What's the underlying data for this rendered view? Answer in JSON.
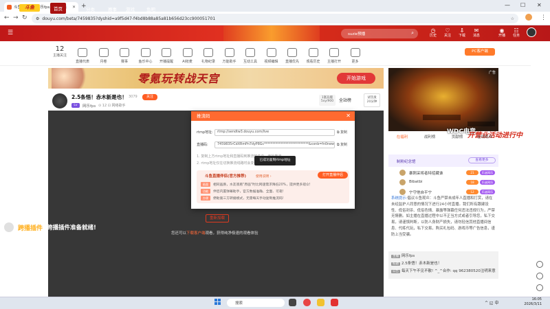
{
  "browser": {
    "tab_title": "斗鱼fps直播_网乐fps直播_网乐",
    "url": "douyu.com/beta/7459835?dyshid=a9f5d47-f4bd8b88a85a81b656d23cc900051701"
  },
  "header": {
    "logo": "斗鱼",
    "nav": [
      "首页",
      "直播",
      "分类",
      "赛事",
      "游戏",
      "鱼吧"
    ],
    "search_placeholder": "suzie预播",
    "icons": [
      {
        "icon": "history-icon",
        "label": "历史"
      },
      {
        "icon": "follow-icon",
        "label": "关注"
      },
      {
        "icon": "download-icon",
        "label": "下载"
      },
      {
        "icon": "message-icon",
        "label": "消息"
      },
      {
        "icon": "live-icon",
        "label": "开播"
      },
      {
        "icon": "task-icon",
        "label": "任务"
      }
    ]
  },
  "categories": {
    "follow_count": "12",
    "follow_label": "主播关注",
    "items": [
      "直播代表",
      "月卷",
      "赛事",
      "鱼乐中心",
      "开播提醒",
      "Al抢麦",
      "礼物纪录",
      "万能助手",
      "互动工具",
      "视频编辑",
      "直播优先",
      "观看历史",
      "主播打开",
      "更多"
    ],
    "pc_button": "PC客户端"
  },
  "ad": {
    "title": "零氪玩转战天宫",
    "button": "开始游戏"
  },
  "stream": {
    "title": "2.5条悟！赤木新是也！",
    "heat": "3079",
    "follow_label": "关注",
    "level": "Lv",
    "streamer": "网乐fps",
    "meta": "⊙ 12  ⊡ 网络歌手",
    "rank_box": "1富兵版\n5xy/900",
    "all_rank": "全站榜",
    "gift_box": "试玩发\n20分钟",
    "plugin_1": "跨播插件",
    "plugin_2": "跨播插件准备就绪!",
    "retry": "重新加载",
    "hint_pre": "您还可以",
    "hint_link": "下载客户端",
    "hint_post": "观看，获得纯净极速的观看体验"
  },
  "modal": {
    "title": "推流码",
    "rtmp_label": "rtmp地址:",
    "rtmp_value": "rtmp://sendtw3.douyu.com/live",
    "key_label": "直播码:",
    "key_value": "7459835rCdXRmPn7dyP8Gc***************************&conb=fn0newsa",
    "copy": "复制",
    "note1": "1. 复制上方rtmp地址和直播码到推流软件中，开始推流",
    "note2": "2. rtmp地址仅在切换推流线路时会变化，直播码有效期为5分钟",
    "toast": "已成功复制rtmp地址",
    "promo_title": "斗鱼直播伴侣(官方推荐)",
    "promo_sub": "使用说明 ›",
    "promo_btn": "打开直播伴侣",
    "promo_rows": [
      {
        "tag": "画面",
        "text": "相同画质，水友观看\"原画\"时比网速需求降低20%，提供更多观众!"
      },
      {
        "tag": "功能",
        "text": "伴侣内置弹幕助手，官方数据准确、全面、可靠!"
      },
      {
        "tag": "方便",
        "text": "便助第三方转播模式，无需每天手动复制推流码!"
      }
    ]
  },
  "right": {
    "ad_label": "广告",
    "wdc": "WDC电竞",
    "wdc_red": "开营业活动进行中",
    "tabs": [
      "在福利",
      "战利榜",
      "贡献榜",
      "在线观众"
    ],
    "fans": "制粉纪念馆",
    "fans_btn": "查看更多",
    "ranks": [
      {
        "name": "暴刚采将者特招藏谁",
        "b1": "21",
        "b2": "乐迷网乐"
      },
      {
        "name": "Bibatbi",
        "b1": "18",
        "b2": "乐迷网乐"
      },
      {
        "name": "宁守他自平宁",
        "b1": "12",
        "b2": "乐迷网乐"
      }
    ],
    "chat_sys": "系统提示:",
    "chat_text": "倡议斗鱼观众：斗鱼严禁未成年人直播和打赏，请在未经监护人同意的情况下进行24小时直播。我们所有跟建设性、低俗封杀、低俗色情、暴露等弹幕任何违法违规行为，严禁无情删。如主播在直播过程中以不正当方式或者引导您，私下交易，请谨慎判断，以防人身财产损失，请勿轻信其他直播间信息、代练代玩，私下交易，购买礼包码、游戏币等广告信息，谨防上当受骗。",
    "room_info": [
      {
        "k": "主播",
        "v": "网乐fps"
      },
      {
        "k": "标题",
        "v": "2.5条悟！赤木新是也！"
      },
      {
        "k": "公告",
        "v": "每天下午不见不散!  ^_^合作: qq 962380520注明来意"
      }
    ]
  },
  "taskbar": {
    "search": "搜索",
    "time": "16:05",
    "date": "2026/3/11",
    "lang": "中"
  }
}
